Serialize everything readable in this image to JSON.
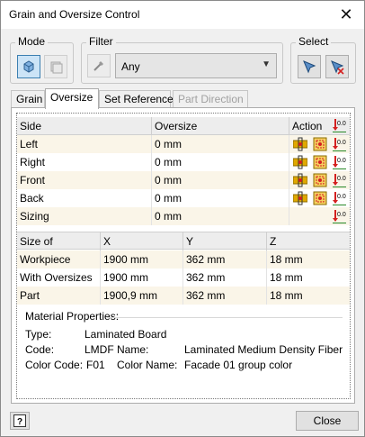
{
  "window": {
    "title": "Grain and Oversize Control",
    "close_glyph": "✕"
  },
  "mode": {
    "label": "Mode"
  },
  "filter": {
    "label": "Filter",
    "value": "Any"
  },
  "select": {
    "label": "Select"
  },
  "tabs": [
    {
      "label": "Grain",
      "state": "normal"
    },
    {
      "label": "Oversize",
      "state": "active"
    },
    {
      "label": "Set Reference",
      "state": "normal"
    },
    {
      "label": "Part Direction",
      "state": "disabled"
    }
  ],
  "oversize_table": {
    "headers": {
      "side": "Side",
      "oversize": "Oversize",
      "action": "Action"
    },
    "action_icon_value": "0.0",
    "rows": [
      {
        "side": "Left",
        "oversize": "0 mm"
      },
      {
        "side": "Right",
        "oversize": "0 mm"
      },
      {
        "side": "Front",
        "oversize": "0 mm"
      },
      {
        "side": "Back",
        "oversize": "0 mm"
      },
      {
        "side": "Sizing",
        "oversize": "0 mm"
      }
    ]
  },
  "size_table": {
    "headers": {
      "size_of": "Size of",
      "x": "X",
      "y": "Y",
      "z": "Z"
    },
    "rows": [
      {
        "name": "Workpiece",
        "x": "1900 mm",
        "y": "362 mm",
        "z": "18 mm"
      },
      {
        "name": "With Oversizes",
        "x": "1900 mm",
        "y": "362 mm",
        "z": "18 mm"
      },
      {
        "name": "Part",
        "x": "1900,9 mm",
        "y": "362 mm",
        "z": "18 mm"
      }
    ]
  },
  "material": {
    "heading": "Material Properties:",
    "type_label": "Type:",
    "type_value": "Laminated Board",
    "code_label": "Code:",
    "code_value": "LMDF",
    "name_label": "Name:",
    "name_value": "Laminated Medium Density Fiber",
    "color_code_label": "Color Code:",
    "color_code_value": "F01",
    "color_name_label": "Color Name:",
    "color_name_value": "Facade 01 group color"
  },
  "footer": {
    "help_glyph": "?",
    "close_label": "Close"
  },
  "colors": {
    "accent": "#3c7fb1",
    "row_alt": "#faf5e8",
    "icon_red": "#d42020",
    "icon_green": "#2a8a2a",
    "icon_gold": "#e0a800"
  }
}
